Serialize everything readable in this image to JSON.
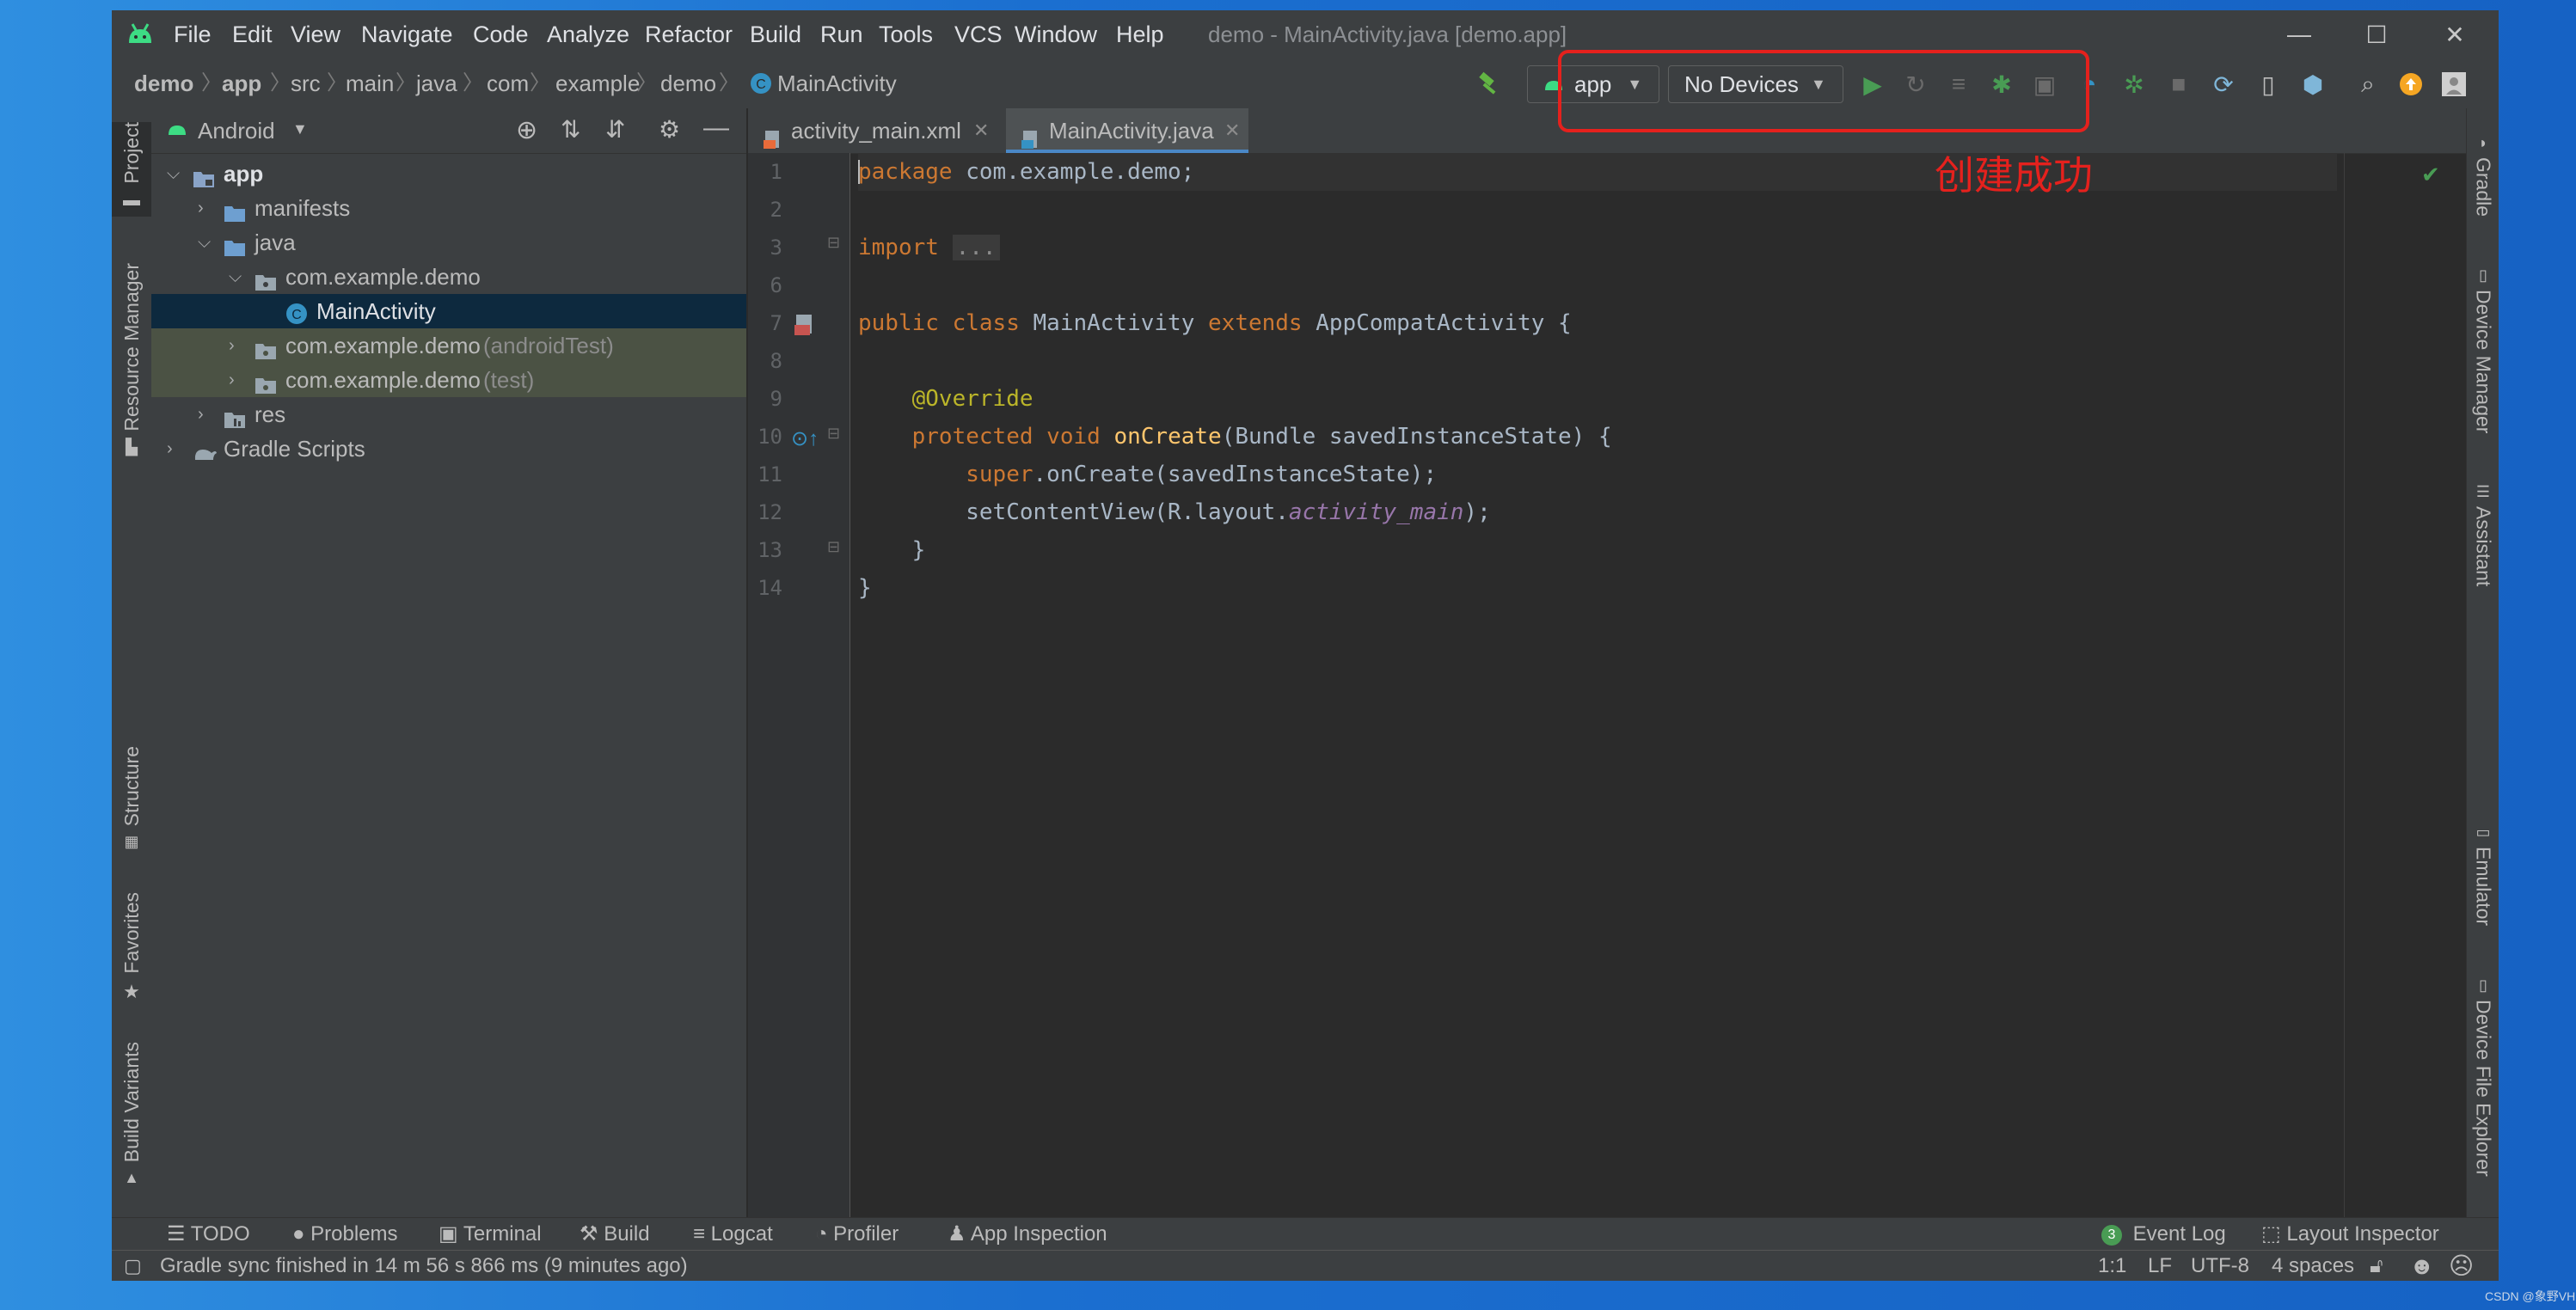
{
  "window": {
    "title": "demo - MainActivity.java [demo.app]",
    "menu": [
      "File",
      "Edit",
      "View",
      "Navigate",
      "Code",
      "Analyze",
      "Refactor",
      "Build",
      "Run",
      "Tools",
      "VCS",
      "Window",
      "Help"
    ]
  },
  "breadcrumb": [
    "demo",
    "app",
    "src",
    "main",
    "java",
    "com",
    "example",
    "demo",
    "MainActivity"
  ],
  "toolbar": {
    "run_config": "app",
    "device": "No Devices"
  },
  "left_stripe": {
    "top": [
      "Project",
      "Resource Manager"
    ],
    "bottom": [
      "Structure",
      "Favorites",
      "Build Variants"
    ]
  },
  "project_panel": {
    "view_mode": "Android",
    "tree": [
      {
        "label": "app",
        "bold": true,
        "depth": 0,
        "expanded": true,
        "icon": "module-folder-icon"
      },
      {
        "label": "manifests",
        "depth": 1,
        "expanded": false,
        "icon": "folder-icon"
      },
      {
        "label": "java",
        "depth": 1,
        "expanded": true,
        "icon": "folder-icon"
      },
      {
        "label": "com.example.demo",
        "depth": 2,
        "expanded": true,
        "icon": "package-icon"
      },
      {
        "label": "MainActivity",
        "depth": 3,
        "selected": true,
        "icon": "class-icon"
      },
      {
        "label": "com.example.demo",
        "suffix": "(androidTest)",
        "depth": 2,
        "expanded": false,
        "icon": "package-icon",
        "highlight": true
      },
      {
        "label": "com.example.demo",
        "suffix": "(test)",
        "depth": 2,
        "expanded": false,
        "icon": "package-icon",
        "highlight": true
      },
      {
        "label": "res",
        "depth": 1,
        "expanded": false,
        "icon": "res-folder-icon"
      },
      {
        "label": "Gradle Scripts",
        "depth": 0,
        "expanded": false,
        "icon": "gradle-icon"
      }
    ]
  },
  "editor": {
    "tabs": [
      {
        "label": "activity_main.xml",
        "active": false
      },
      {
        "label": "MainActivity.java",
        "active": true
      }
    ],
    "line_numbers": [
      "1",
      "2",
      "3",
      "6",
      "7",
      "8",
      "9",
      "10",
      "11",
      "12",
      "13",
      "14"
    ],
    "code": {
      "l1_kw": "package",
      "l1_rest": " com.example.demo;",
      "l3_kw": "import",
      "l3_fold": "...",
      "l7_a": "public",
      "l7_b": "class",
      "l7_c": " MainActivity ",
      "l7_d": "extends",
      "l7_e": " AppCompatActivity {",
      "l9": "@Override",
      "l10_a": "protected",
      "l10_b": "void",
      "l10_c": "onCreate",
      "l10_d": "(Bundle savedInstanceState) {",
      "l11_a": "super",
      "l11_b": ".onCreate(savedInstanceState);",
      "l12_a": "setContentView(R.layout.",
      "l12_b": "activity_main",
      "l12_c": ");",
      "l13": "}",
      "l14": "}"
    }
  },
  "right_stripe": [
    "Gradle",
    "Device Manager",
    "Assistant",
    "Emulator",
    "Device File Explorer"
  ],
  "bottom_tabs": [
    "TODO",
    "Problems",
    "Terminal",
    "Build",
    "Logcat",
    "Profiler",
    "App Inspection"
  ],
  "bottom_right": {
    "event_log": "Event Log",
    "event_count": "3",
    "layout_inspector": "Layout Inspector"
  },
  "status": {
    "message": "Gradle sync finished in 14 m 56 s 866 ms (9 minutes ago)",
    "position": "1:1",
    "line_sep": "LF",
    "encoding": "UTF-8",
    "indent": "4 spaces"
  },
  "annotation": {
    "text": "创建成功",
    "color": "#e5211d"
  },
  "watermark": "CSDN @象野VH"
}
